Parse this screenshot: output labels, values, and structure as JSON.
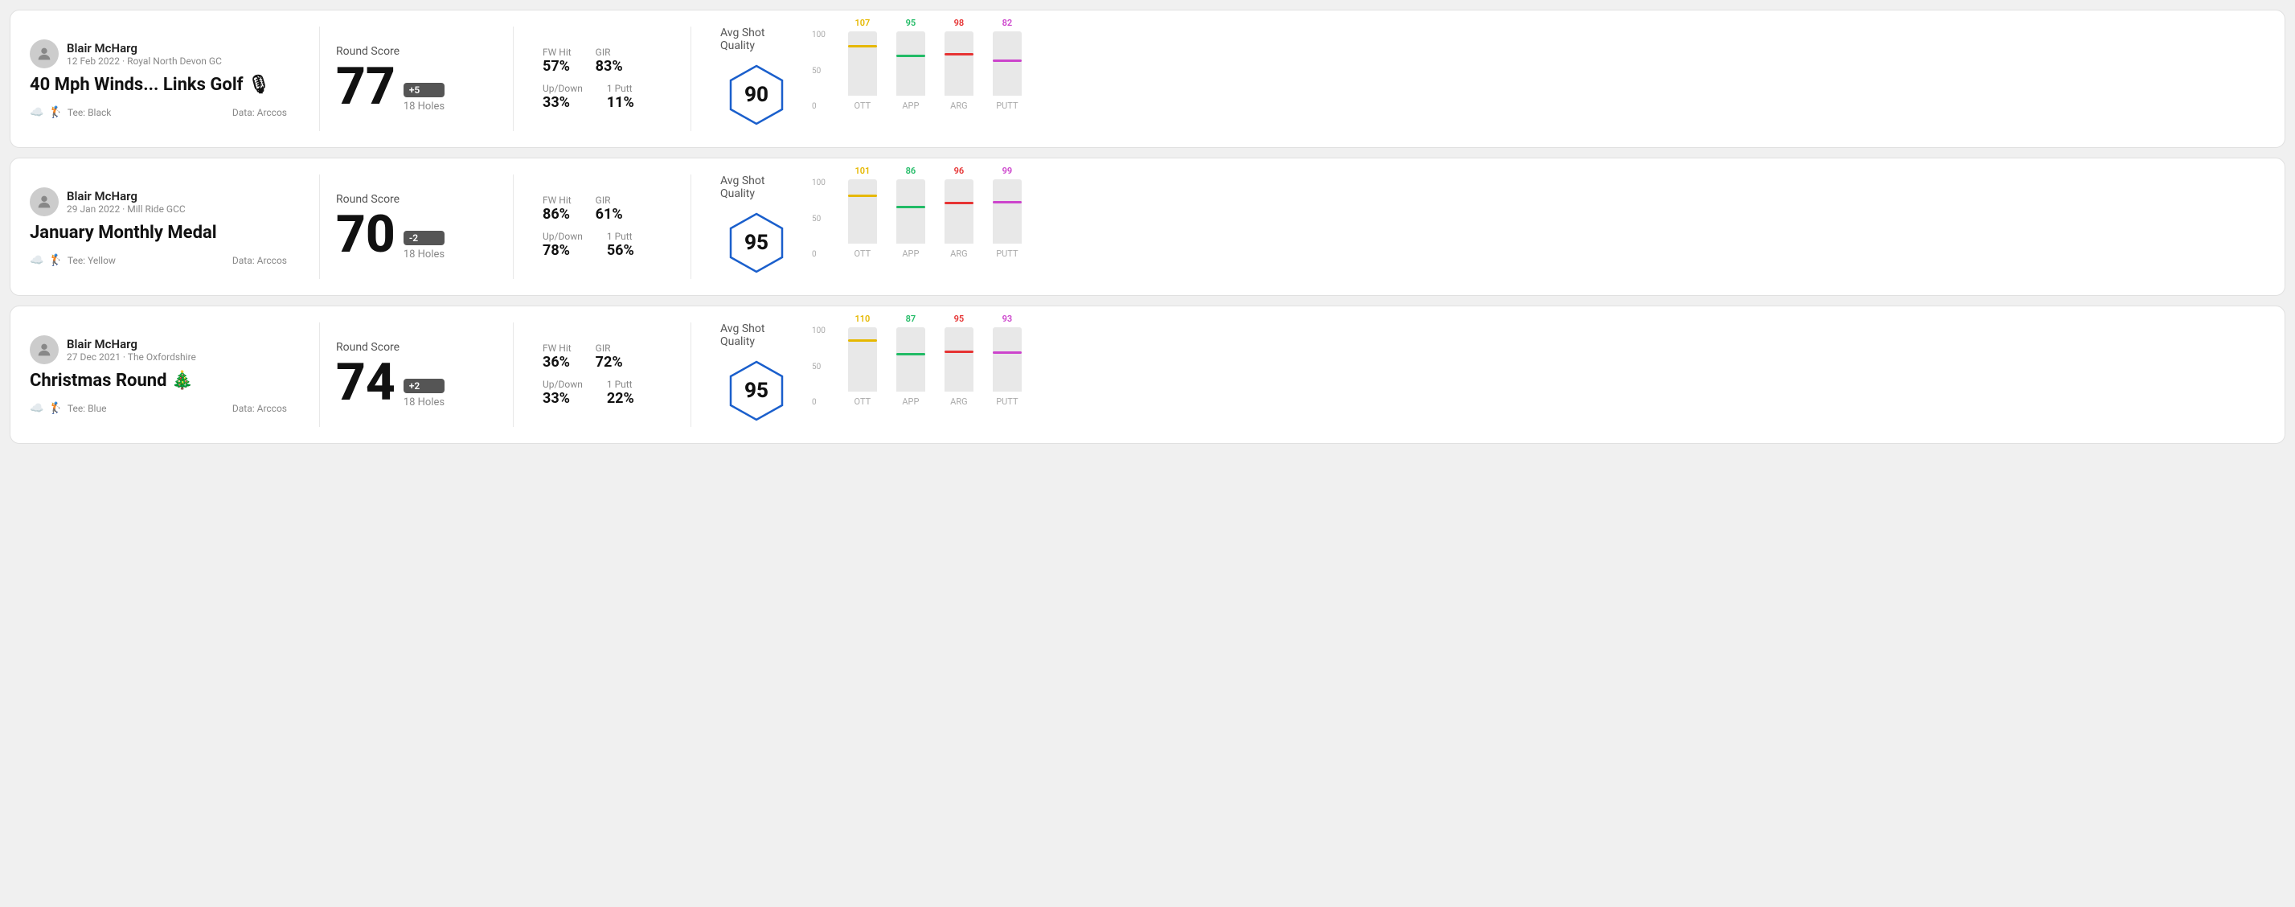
{
  "rounds": [
    {
      "id": "round-1",
      "user": {
        "name": "Blair McHarg",
        "date": "12 Feb 2022 · Royal North Devon GC"
      },
      "title": "40 Mph Winds... Links Golf 🎙",
      "tee": "Black",
      "data_source": "Data: Arccos",
      "round_score_label": "Round Score",
      "score": "77",
      "score_badge": "+5",
      "holes": "18 Holes",
      "fw_hit_label": "FW Hit",
      "fw_hit": "57%",
      "gir_label": "GIR",
      "gir": "83%",
      "updown_label": "Up/Down",
      "updown": "33%",
      "oneputt_label": "1 Putt",
      "oneputt": "11%",
      "quality_label": "Avg Shot Quality",
      "quality_score": "90",
      "chart": {
        "bars": [
          {
            "label": "OTT",
            "value": 107,
            "color": "#e6b800",
            "pct": 75
          },
          {
            "label": "APP",
            "value": 95,
            "color": "#22bb66",
            "pct": 60
          },
          {
            "label": "ARG",
            "value": 98,
            "color": "#e63333",
            "pct": 62
          },
          {
            "label": "PUTT",
            "value": 82,
            "color": "#cc44cc",
            "pct": 52
          }
        ],
        "y_labels": [
          "100",
          "50",
          "0"
        ]
      }
    },
    {
      "id": "round-2",
      "user": {
        "name": "Blair McHarg",
        "date": "29 Jan 2022 · Mill Ride GCC"
      },
      "title": "January Monthly Medal",
      "tee": "Yellow",
      "data_source": "Data: Arccos",
      "round_score_label": "Round Score",
      "score": "70",
      "score_badge": "-2",
      "holes": "18 Holes",
      "fw_hit_label": "FW Hit",
      "fw_hit": "86%",
      "gir_label": "GIR",
      "gir": "61%",
      "updown_label": "Up/Down",
      "updown": "78%",
      "oneputt_label": "1 Putt",
      "oneputt": "56%",
      "quality_label": "Avg Shot Quality",
      "quality_score": "95",
      "chart": {
        "bars": [
          {
            "label": "OTT",
            "value": 101,
            "color": "#e6b800",
            "pct": 72
          },
          {
            "label": "APP",
            "value": 86,
            "color": "#22bb66",
            "pct": 55
          },
          {
            "label": "ARG",
            "value": 96,
            "color": "#e63333",
            "pct": 61
          },
          {
            "label": "PUTT",
            "value": 99,
            "color": "#cc44cc",
            "pct": 63
          }
        ],
        "y_labels": [
          "100",
          "50",
          "0"
        ]
      }
    },
    {
      "id": "round-3",
      "user": {
        "name": "Blair McHarg",
        "date": "27 Dec 2021 · The Oxfordshire"
      },
      "title": "Christmas Round 🎄",
      "tee": "Blue",
      "data_source": "Data: Arccos",
      "round_score_label": "Round Score",
      "score": "74",
      "score_badge": "+2",
      "holes": "18 Holes",
      "fw_hit_label": "FW Hit",
      "fw_hit": "36%",
      "gir_label": "GIR",
      "gir": "72%",
      "updown_label": "Up/Down",
      "updown": "33%",
      "oneputt_label": "1 Putt",
      "oneputt": "22%",
      "quality_label": "Avg Shot Quality",
      "quality_score": "95",
      "chart": {
        "bars": [
          {
            "label": "OTT",
            "value": 110,
            "color": "#e6b800",
            "pct": 78
          },
          {
            "label": "APP",
            "value": 87,
            "color": "#22bb66",
            "pct": 56
          },
          {
            "label": "ARG",
            "value": 95,
            "color": "#e63333",
            "pct": 60
          },
          {
            "label": "PUTT",
            "value": 93,
            "color": "#cc44cc",
            "pct": 59
          }
        ],
        "y_labels": [
          "100",
          "50",
          "0"
        ]
      }
    }
  ]
}
